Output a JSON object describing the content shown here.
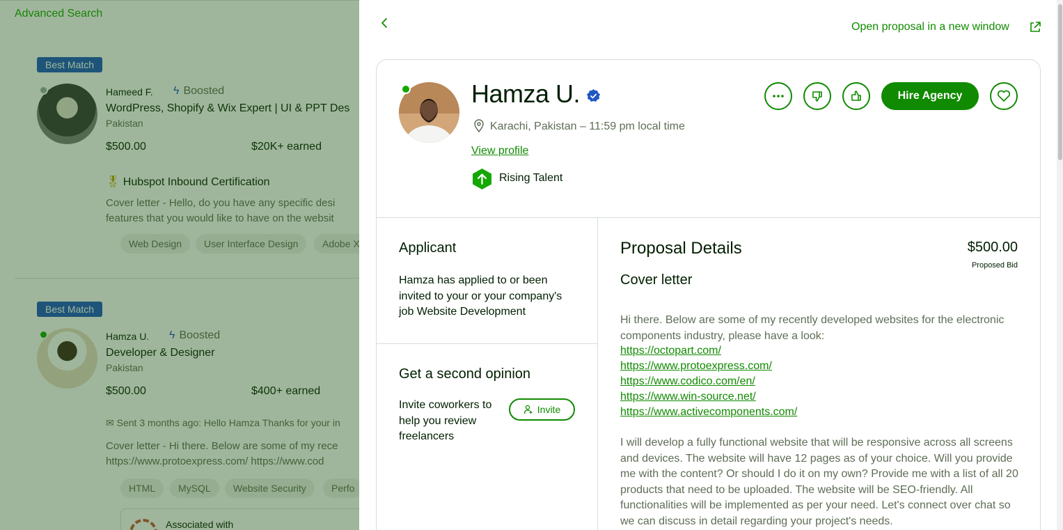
{
  "background": {
    "advanced_search": "Advanced Search",
    "cards": [
      {
        "badge": "Best Match",
        "name": "Hameed F.",
        "boosted": "Boosted",
        "title": "WordPress, Shopify & Wix Expert | UI & PPT Des",
        "country": "Pakistan",
        "rate": "$500.00",
        "earned": "$20K+ earned",
        "certification": "Hubspot Inbound Certification",
        "cover_line1": "Cover letter - Hello, do you have any specific desi",
        "cover_line2": "features that you would like to have on the websit",
        "chips": [
          "Web Design",
          "User Interface Design",
          "Adobe X"
        ]
      },
      {
        "badge": "Best Match",
        "name": "Hamza U.",
        "boosted": "Boosted",
        "title": "Developer & Designer",
        "country": "Pakistan",
        "rate": "$500.00",
        "earned": "$400+ earned",
        "sent": "Sent 3 months ago: Hello Hamza Thanks for your in",
        "cover_line1": "Cover letter - Hi there. Below are some of my rece",
        "cover_line2": "https://www.protoexpress.com/ https://www.cod",
        "chips": [
          "HTML",
          "MySQL",
          "Website Security",
          "Perfo"
        ],
        "associated": "Associated with"
      }
    ]
  },
  "panel": {
    "open_new_window": "Open proposal in a new window",
    "freelancer": {
      "name": "Hamza U.",
      "location": "Karachi, Pakistan – 11:59 pm local time",
      "view_profile": "View profile",
      "badge": "Rising Talent"
    },
    "actions": {
      "hire": "Hire Agency"
    },
    "applicant": {
      "title": "Applicant",
      "text": "Hamza has applied to or been invited to your or your company's job ",
      "job": "Website Development"
    },
    "second_opinion": {
      "title": "Get a second opinion",
      "text": "Invite coworkers to help you review freelancers",
      "invite": "Invite"
    },
    "proposal": {
      "title": "Proposal Details",
      "bid": "$500.00",
      "bid_label": "Proposed Bid",
      "cover_title": "Cover letter",
      "intro": "Hi there. Below are some of my recently developed websites for the electronic components industry, please have a look:",
      "links": [
        "https://octopart.com/",
        "https://www.protoexpress.com/",
        "https://www.codico.com/en/",
        "https://www.win-source.net/",
        "https://www.activecomponents.com/"
      ],
      "body": "I will develop a fully functional website that will be responsive across all screens and devices. The website will have 12 pages as of your choice. Will you provide me with the content? Or should I do it on my own? Provide me with a list of all 20 products that need to be uploaded. The website will be SEO-friendly. All functionalities will be implemented as per your need. Let's connect over chat so we can discuss in detail regarding your project's needs."
    }
  }
}
